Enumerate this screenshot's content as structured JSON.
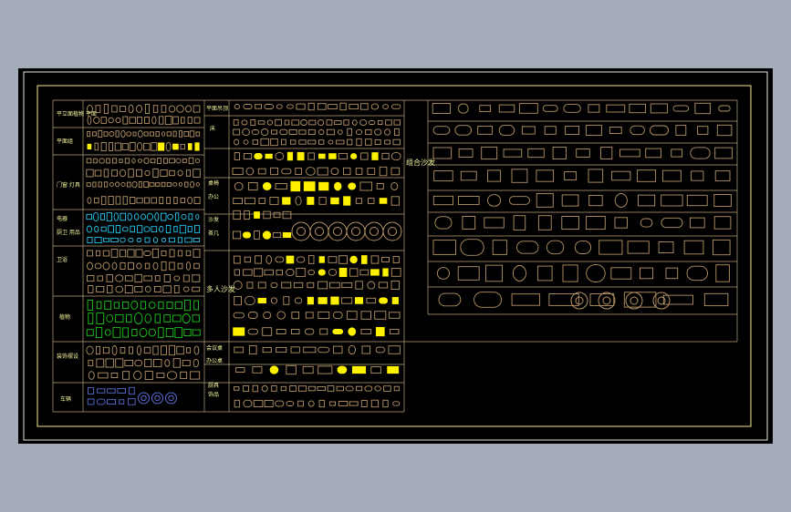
{
  "drawing": {
    "title": "组合沙发",
    "colors": {
      "background": "#000000",
      "frame_outer": "#e6e6e6",
      "frame_inner": "#f0e890",
      "grid": "#b8a27a",
      "block": "#b69468",
      "label": "#f5f5a0",
      "highlight": "#fff200",
      "green": "#1ec81e",
      "cyan": "#28c8f0",
      "blue": "#5a6ed2"
    },
    "left_labels": [
      "平立面植物 平面",
      "平面组",
      "门窗 灯具",
      "电器",
      "厨卫 用品",
      "卫浴",
      "植物",
      "装饰摆设",
      "车辆"
    ],
    "mid_labels": [
      "平面吊顶",
      "床",
      "桌椅",
      "办公",
      "沙发",
      "茶几",
      "多人沙发",
      "会议桌",
      "办公桌",
      "厨具",
      "饰品"
    ],
    "right_label": "组合沙发"
  }
}
